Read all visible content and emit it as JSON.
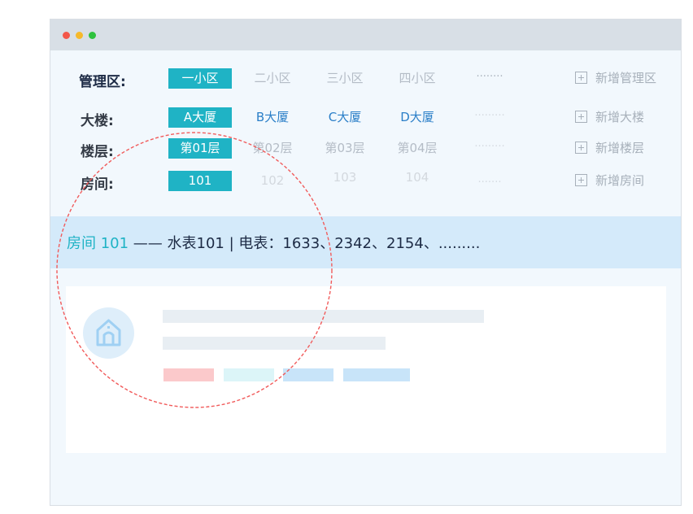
{
  "window": {
    "traffic_lights": [
      "close",
      "minimize",
      "maximize"
    ]
  },
  "filters": {
    "management": {
      "label": "管理区:",
      "options": [
        "一小区",
        "二小区",
        "三小区",
        "四小区"
      ],
      "more": "········",
      "add": "新增管理区"
    },
    "building": {
      "label": "大楼:",
      "options": [
        "A大厦",
        "B大厦",
        "C大厦",
        "D大厦"
      ],
      "more": "·········",
      "add": "新增大楼"
    },
    "floor": {
      "label": "楼层:",
      "options": [
        "第01层",
        "第02层",
        "第03层",
        "第04层"
      ],
      "more": "·········",
      "add": "新增楼层"
    },
    "room": {
      "label": "房间:",
      "options": [
        "101",
        "102",
        "103",
        "104"
      ],
      "more": "·······",
      "add": "新增房间"
    }
  },
  "info": {
    "room": "房间 101",
    "separator": " —— ",
    "detail": "水表101 | 电表：1633、2342、2154、........."
  },
  "card": {
    "icon": "home-icon",
    "tag_colors": [
      "#fbc9cb",
      "#dcf5f8",
      "#c8e4f9",
      "#c8e4f9"
    ]
  },
  "colors": {
    "accent": "#1fb3c5",
    "link": "#2b7fc8",
    "info_bar": "#d4eafa",
    "circle": "#f15b5b"
  }
}
